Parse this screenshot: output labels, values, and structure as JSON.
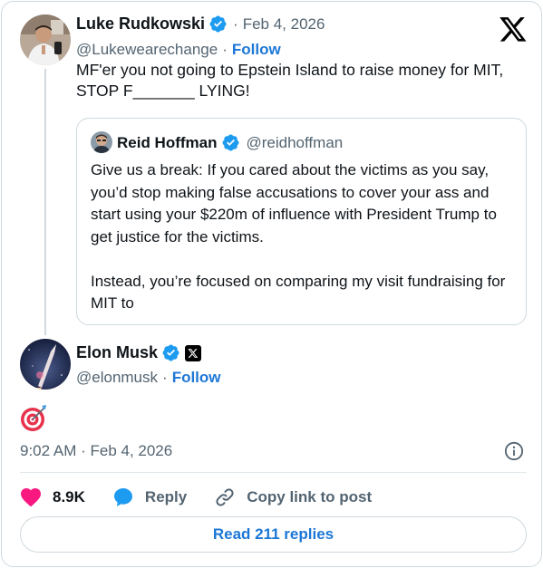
{
  "main_tweet": {
    "author_name": "Luke Rudkowski",
    "date": "Feb 4, 2026",
    "handle": "@Lukewearechange",
    "follow_label": "Follow",
    "text": "MF'er you not going to Epstein Island to raise money for MIT, STOP F_______ LYING!"
  },
  "quoted_tweet": {
    "author_name": "Reid Hoffman",
    "handle": "@reidhoffman",
    "paragraphs": [
      "Give us a break: If you cared about the victims as you say, you’d stop making false accusations to cover your ass and start using your $220m of influence with President Trump to get justice for the victims.",
      "Instead, you’re focused on comparing my visit fundraising for MIT to"
    ]
  },
  "reply_tweet": {
    "author_name": "Elon Musk",
    "handle": "@elonmusk",
    "follow_label": "Follow",
    "timestamp": "9:02 AM · Feb 4, 2026"
  },
  "actions": {
    "like_count": "8.9K",
    "reply_label": "Reply",
    "copy_label": "Copy link to post"
  },
  "read_replies_label": "Read 211 replies",
  "colors": {
    "accent": "#1d77d6",
    "verified": "#1d9bf0",
    "like": "#f91880",
    "muted": "#536471"
  },
  "icons": [
    "x-logo-icon",
    "verified-icon",
    "x-badge-icon",
    "direct-hit-emoji-icon",
    "info-icon",
    "heart-icon",
    "reply-bubble-icon",
    "link-icon"
  ]
}
